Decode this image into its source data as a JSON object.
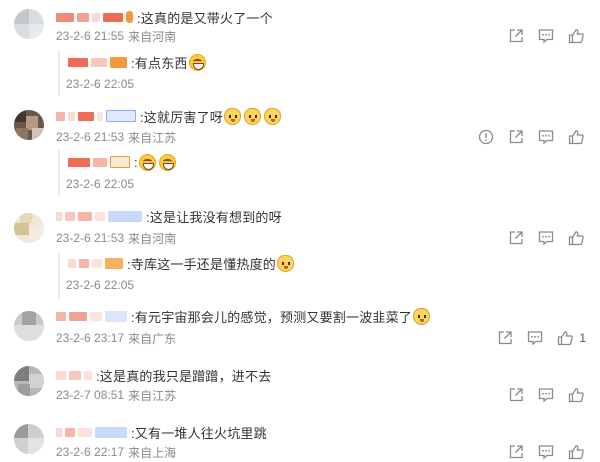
{
  "comments": [
    {
      "text": ":这真的是又带火了一个",
      "time": "23-2-6 21:55",
      "location": "来自河南",
      "reply": {
        "text": ":有点东西",
        "time": "23-2-6 22:05"
      }
    },
    {
      "text": ":这就厉害了呀",
      "time": "23-2-6 21:53",
      "location": "来自江苏",
      "reply": {
        "text": ":",
        "time": "23-2-6 22:05"
      }
    },
    {
      "text": ":这是让我没有想到的呀",
      "time": "23-2-6 21:53",
      "location": "来自河南",
      "reply": {
        "text": ":寺库这一手还是懂热度的",
        "time": "23-2-6 22:05"
      }
    },
    {
      "text": ":有元宇宙那会儿的感觉，预测又要割一波韭菜了",
      "time": "23-2-6 23:17",
      "location": "来自广东",
      "like_count": "1"
    },
    {
      "text": ":这是真的我只是蹭蹭，进不去",
      "time": "23-2-7 08:51",
      "location": "来自江苏"
    },
    {
      "text": ":又有一堆人往火坑里跳",
      "time": "23-2-6 22:17",
      "location": "来自上海"
    }
  ],
  "icons": [
    "forward-icon",
    "comment-icon",
    "like-icon",
    "report-icon",
    "laugh-emoji-icon",
    "dog-emoji-icon"
  ],
  "colors": {
    "meta": "#8a8a8a",
    "text": "#333333",
    "icon": "#8a8a8a",
    "reply_border": "#ebebeb"
  }
}
